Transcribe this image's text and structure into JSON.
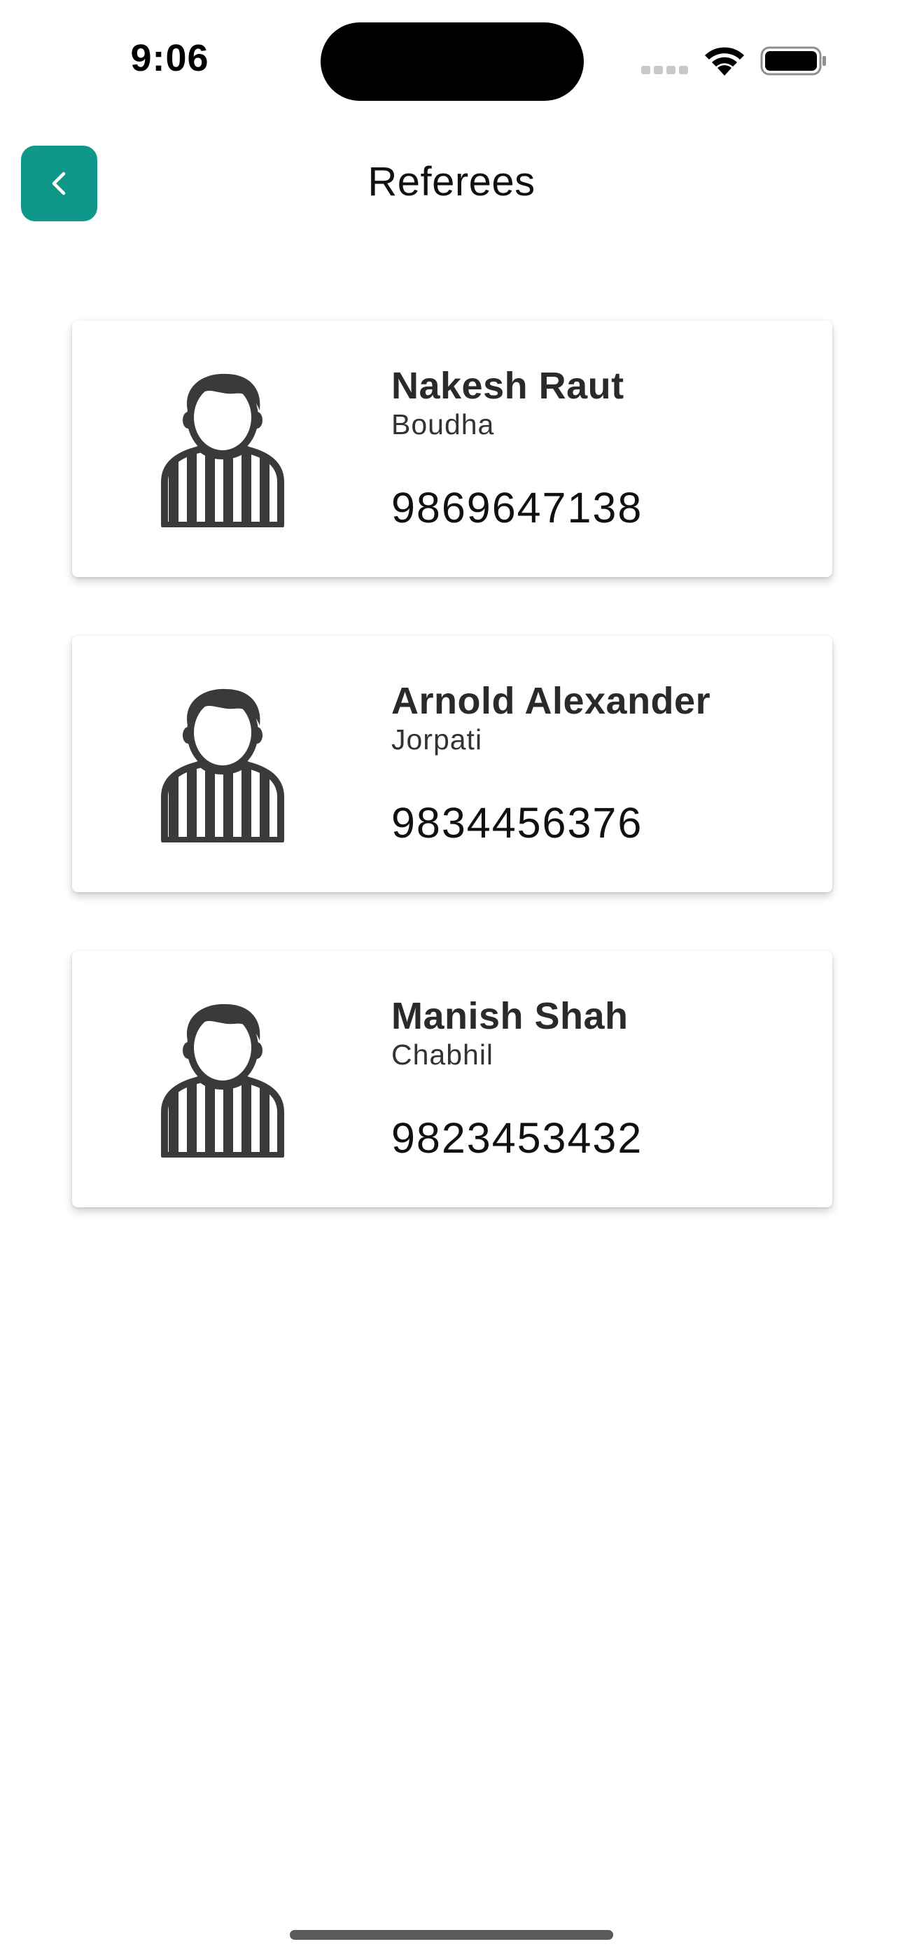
{
  "status_bar": {
    "time": "9:06"
  },
  "header": {
    "title": "Referees",
    "back_icon": "chevron-left-icon"
  },
  "colors": {
    "accent": "#0f978a",
    "text_dark": "#2a2a2a",
    "avatar": "#3a3a3a"
  },
  "referees": [
    {
      "name": "Nakesh Raut",
      "location": "Boudha",
      "phone": "9869647138",
      "icon": "referee-avatar-icon"
    },
    {
      "name": "Arnold Alexander",
      "location": "Jorpati",
      "phone": "9834456376",
      "icon": "referee-avatar-icon"
    },
    {
      "name": "Manish Shah",
      "location": "Chabhil",
      "phone": "9823453432",
      "icon": "referee-avatar-icon"
    }
  ]
}
